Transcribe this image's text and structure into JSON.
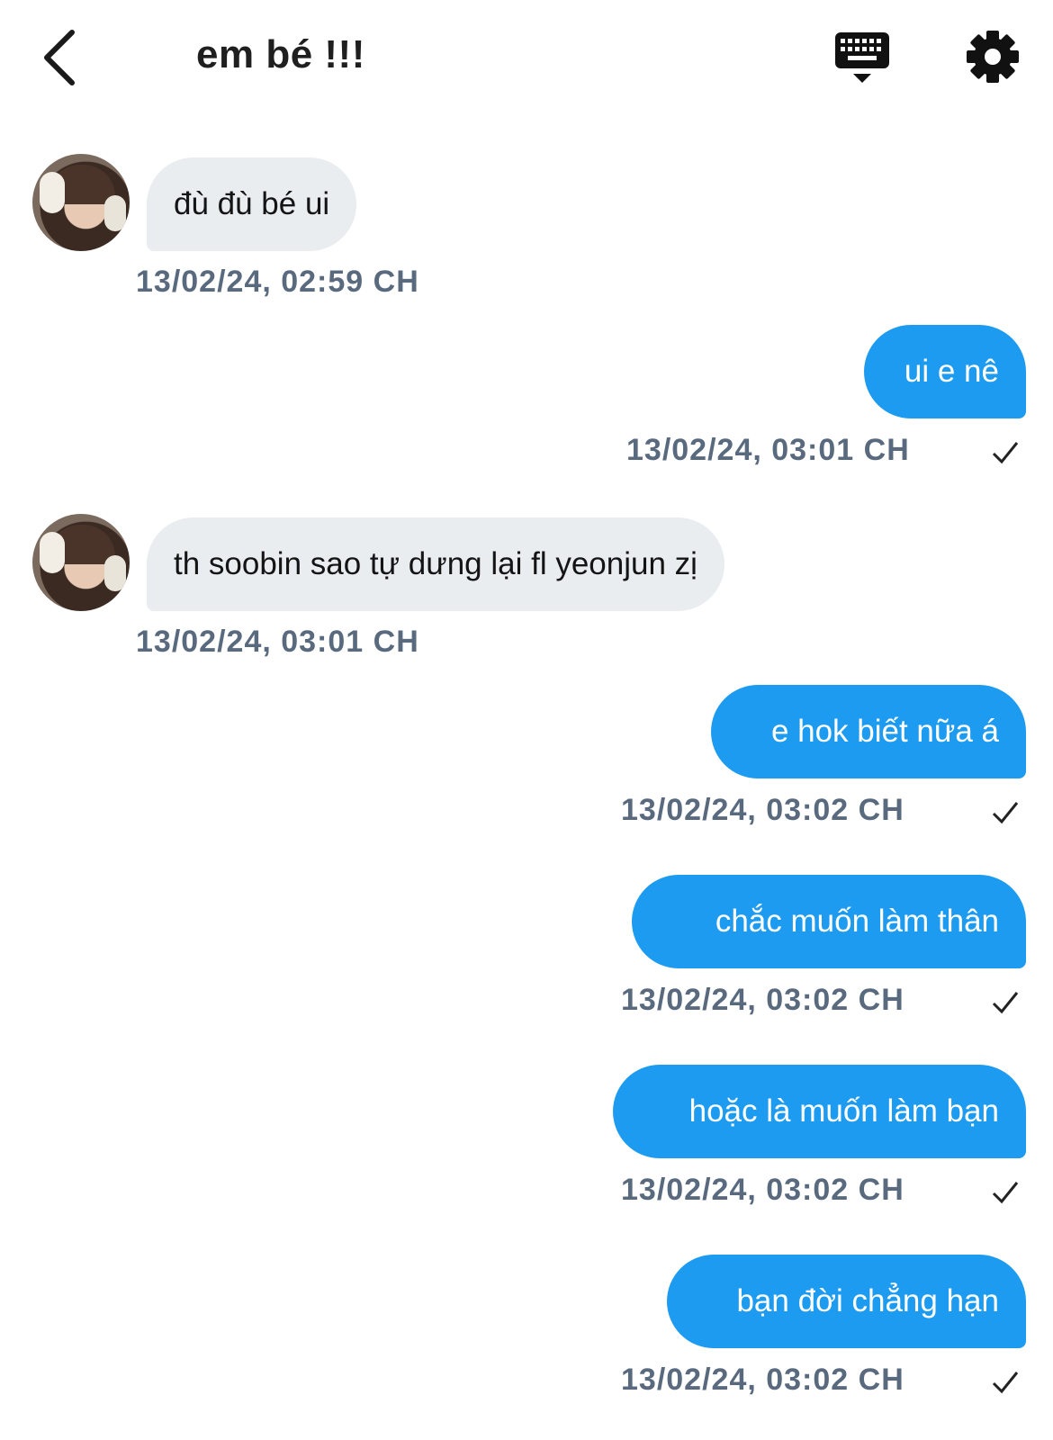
{
  "header": {
    "title": "em bé !!!",
    "back_icon": "chevron-left-icon",
    "keyboard_icon": "keyboard-icon",
    "settings_icon": "gear-icon"
  },
  "colors": {
    "outgoing_bubble": "#1d9bf0",
    "incoming_bubble": "#e9edf0",
    "timestamp": "#5a6a7e"
  },
  "messages": [
    {
      "direction": "incoming",
      "text": "đù đù bé ui",
      "time": "13/02/24, 02:59 CH"
    },
    {
      "direction": "outgoing",
      "text": "ui e nê",
      "time": "13/02/24, 03:01 CH",
      "status_icon": "checkmark-icon"
    },
    {
      "direction": "incoming",
      "text": "th soobin sao tự dưng lại fl yeonjun zị",
      "time": "13/02/24, 03:01 CH"
    },
    {
      "direction": "outgoing",
      "text": "e hok biết nữa á",
      "time": "13/02/24, 03:02 CH",
      "status_icon": "checkmark-icon"
    },
    {
      "direction": "outgoing",
      "text": "chắc muốn làm thân",
      "time": "13/02/24, 03:02 CH",
      "status_icon": "checkmark-icon"
    },
    {
      "direction": "outgoing",
      "text": "hoặc là muốn làm bạn",
      "time": "13/02/24, 03:02 CH",
      "status_icon": "checkmark-icon"
    },
    {
      "direction": "outgoing",
      "text": "bạn đời chẳng hạn",
      "time": "13/02/24, 03:02 CH",
      "status_icon": "checkmark-icon"
    }
  ]
}
